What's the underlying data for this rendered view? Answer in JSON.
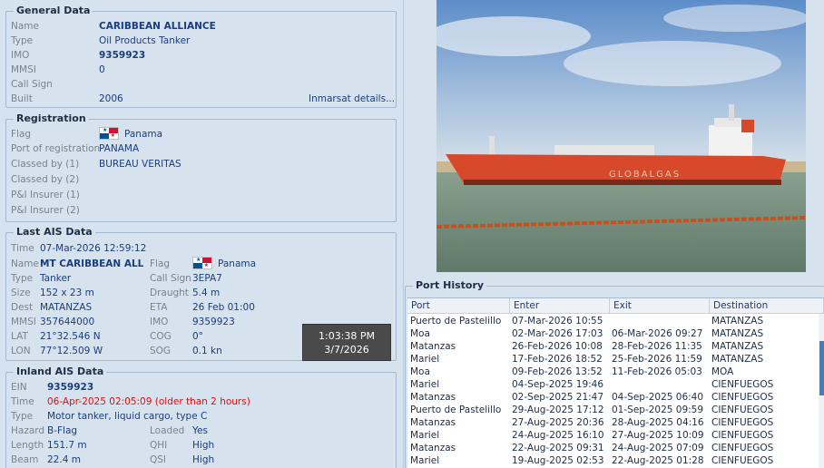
{
  "general": {
    "title": "General Data",
    "labels": {
      "name": "Name",
      "type": "Type",
      "imo": "IMO",
      "mmsi": "MMSI",
      "callsign": "Call Sign",
      "built": "Built"
    },
    "name": "CARIBBEAN ALLIANCE",
    "type": "Oil Products Tanker",
    "imo": "9359923",
    "mmsi": "0",
    "callsign": "",
    "built": "2006",
    "inmarsat_link": "Inmarsat details..."
  },
  "registration": {
    "title": "Registration",
    "labels": {
      "flag": "Flag",
      "port": "Port of registration",
      "classed1": "Classed by (1)",
      "classed2": "Classed by (2)",
      "pi1": "P&I Insurer (1)",
      "pi2": "P&I Insurer (2)"
    },
    "flag": "Panama",
    "port": "PANAMA",
    "classed1": "BUREAU VERITAS",
    "classed2": "",
    "pi1": "",
    "pi2": ""
  },
  "ais": {
    "title": "Last AIS Data",
    "labels": {
      "time": "Time",
      "name": "Name",
      "type": "Type",
      "size": "Size",
      "dest": "Dest",
      "mmsi": "MMSI",
      "lat": "LAT",
      "lon": "LON",
      "flag": "Flag",
      "callsign": "Call Sign",
      "draught": "Draught",
      "eta": "ETA",
      "imo": "IMO",
      "cog": "COG",
      "sog": "SOG"
    },
    "time": "07-Mar-2026 12:59:12",
    "name": "MT CARIBBEAN ALLIA",
    "type": "Tanker",
    "size": "152 x 23 m",
    "dest": "MATANZAS",
    "mmsi": "357644000",
    "lat": "21°32.546 N",
    "lon": "77°12.509 W",
    "flag": "Panama",
    "callsign": "3EPA7",
    "draught": "5.4 m",
    "eta": "26 Feb 01:00",
    "imo": "9359923",
    "cog": "0°",
    "sog": "0.1 kn"
  },
  "clock": {
    "time": "1:03:38 PM",
    "date": "3/7/2026"
  },
  "inland": {
    "title": "Inland AIS Data",
    "labels": {
      "ein": "EIN",
      "time": "Time",
      "type": "Type",
      "hazard": "Hazard",
      "length": "Length",
      "beam": "Beam",
      "loaded": "Loaded",
      "qhi": "QHI",
      "qsi": "QSI"
    },
    "ein": "9359923",
    "time": "06-Apr-2025 02:05:09 (older than 2 hours)",
    "type": "Motor tanker, liquid cargo, type C",
    "hazard": "B-Flag",
    "length": "151.7 m",
    "beam": "22.4 m",
    "loaded": "Yes",
    "qhi": "High",
    "qsi": "High"
  },
  "port_history": {
    "title": "Port History",
    "columns": [
      "Port",
      "Enter",
      "Exit",
      "Destination"
    ],
    "rows": [
      [
        "Puerto de Pastelillo",
        "07-Mar-2026 10:55",
        "",
        "MATANZAS"
      ],
      [
        "Moa",
        "02-Mar-2026 17:03",
        "06-Mar-2026 09:27",
        "MATANZAS"
      ],
      [
        "Matanzas",
        "26-Feb-2026 10:08",
        "28-Feb-2026 11:35",
        "MATANZAS"
      ],
      [
        "Mariel",
        "17-Feb-2026 18:52",
        "25-Feb-2026 11:59",
        "MATANZAS"
      ],
      [
        "Moa",
        "09-Feb-2026 13:52",
        "11-Feb-2026 05:03",
        "MOA"
      ],
      [
        "Mariel",
        "04-Sep-2025 19:46",
        "",
        "CIENFUEGOS"
      ],
      [
        "Matanzas",
        "02-Sep-2025 21:47",
        "04-Sep-2025 06:40",
        "CIENFUEGOS"
      ],
      [
        "Puerto de Pastelillo",
        "29-Aug-2025 17:12",
        "01-Sep-2025 09:59",
        "CIENFUEGOS"
      ],
      [
        "Matanzas",
        "27-Aug-2025 20:36",
        "28-Aug-2025 04:16",
        "CIENFUEGOS"
      ],
      [
        "Mariel",
        "24-Aug-2025 16:10",
        "27-Aug-2025 10:09",
        "CIENFUEGOS"
      ],
      [
        "Matanzas",
        "22-Aug-2025 09:31",
        "24-Aug-2025 07:09",
        "CIENFUEGOS"
      ],
      [
        "Mariel",
        "19-Aug-2025 02:53",
        "22-Aug-2025 01:28",
        "CIENFUEGOS"
      ]
    ]
  },
  "photo": {
    "hull_text": "GLOBALGAS"
  },
  "colors": {
    "panel_bg": "#d6e2ee",
    "value_text": "#1a3d7c",
    "label_text": "#7a8290",
    "warning_text": "#e01010",
    "hull": "#d8482a"
  }
}
